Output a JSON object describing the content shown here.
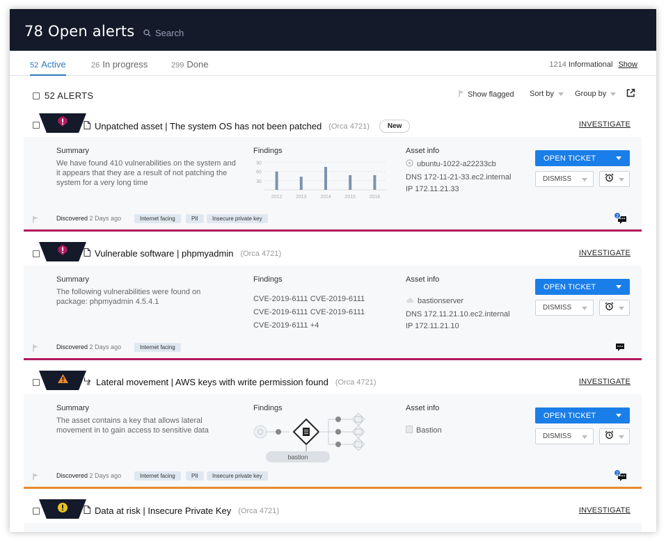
{
  "header": {
    "title": "78 Open alerts",
    "search_placeholder": "Search"
  },
  "tabs": [
    {
      "count": "52",
      "label": "Active"
    },
    {
      "count": "26",
      "label": "In progress"
    },
    {
      "count": "299",
      "label": "Done"
    }
  ],
  "informational": {
    "count": "1214",
    "label": "Informational",
    "show": "Show"
  },
  "toolbar": {
    "count_label": "52 ALERTS",
    "show_flagged": "Show flagged",
    "sort_by": "Sort by",
    "group_by": "Group by"
  },
  "colors": {
    "header_bg": "#141a2a",
    "accent_blue": "#1a7ee8",
    "critical_line": "#b3195f",
    "warning_line": "#e8892a",
    "tag_bg": "#dfe8f1"
  },
  "common": {
    "investigate": "INVESTIGATE",
    "summary": "Summary",
    "findings": "Findings",
    "asset_info": "Asset info",
    "open_ticket": "OPEN TICKET",
    "dismiss": "DISMISS",
    "discovered": "Discovered",
    "ago": "2 Days ago"
  },
  "alerts": [
    {
      "severity_icon": "shield-critical-icon",
      "type_icon": "document-icon",
      "title": "Unpatched asset | The system OS has not been patched",
      "orca": "(Orca 4721)",
      "badge": "New",
      "summary": "We have found 410 vulnerabilities on the system and it appears that they are a result of not patching the system for a very long time",
      "asset": {
        "name": "ubuntu-1022-a22233cb",
        "dns": "DNS 172-11-21-33.ec2.internal",
        "ip": "IP  172.11.21.33"
      },
      "tags": [
        "Internet facing",
        "PII",
        "Insecure private key"
      ],
      "comment_count": "2"
    },
    {
      "severity_icon": "shield-critical-icon",
      "type_icon": "document-icon",
      "title": "Vulnerable software  | phpmyadmin",
      "orca": "(Orca 4721)",
      "summary": "The following vulnerabilities were found on package: phpmyadmin 4.5.4.1",
      "findings_cves": [
        "CVE-2019-6111  CVE-2019-6111",
        "CVE-2019-6111  CVE-2019-6111",
        "CVE-2019-6111  +4"
      ],
      "asset": {
        "name": "bastionserver",
        "dns": "DNS 172.11.21.10.ec2.internal",
        "ip": "IP  172.11.21.10"
      },
      "tags": [
        "Internet facing"
      ]
    },
    {
      "severity_icon": "warning-triangle-icon",
      "type_icon": "lateral-movement-icon",
      "title": "Lateral movement   | AWS keys with write permission found",
      "orca": "(Orca 4721)",
      "summary": "The asset contains a key that allows lateral movement in to gain access to sensitive data",
      "diagram_label": "bastion",
      "asset": {
        "name": "Bastion"
      },
      "tags": [
        "Internet facing",
        "PII",
        "Insecure private key"
      ],
      "comment_count": "2"
    },
    {
      "severity_icon": "exclamation-circle-icon",
      "type_icon": "document-icon",
      "title": "Data at risk   | Insecure Private Key",
      "orca": "(Orca 4721)"
    }
  ],
  "chart_data": {
    "type": "bar",
    "categories": [
      "2012",
      "2013",
      "2014",
      "2015",
      "2016"
    ],
    "values": [
      60,
      43,
      75,
      48,
      48
    ],
    "yticks": [
      "90",
      "60",
      "30"
    ],
    "ylim": [
      0,
      100
    ]
  }
}
